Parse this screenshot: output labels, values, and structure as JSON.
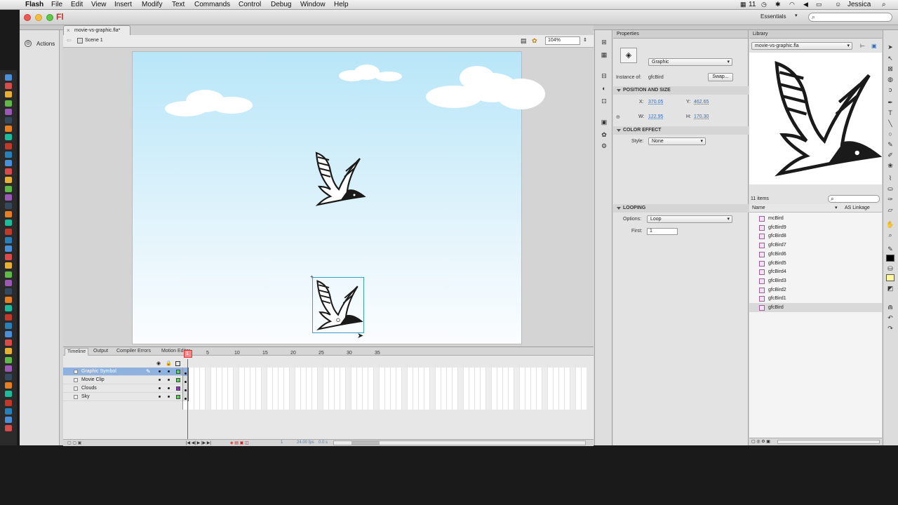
{
  "menubar": {
    "app": "Flash",
    "items": [
      "File",
      "Edit",
      "View",
      "Insert",
      "Modify",
      "Text",
      "Commands",
      "Control",
      "Debug",
      "Window",
      "Help"
    ],
    "status_number": "11",
    "user": "Jessica"
  },
  "app": {
    "logo": "Fl",
    "workspace": "Essentials",
    "actions_label": "Actions"
  },
  "document": {
    "tab": "movie-vs-graphic.fla*",
    "scene": "Scene 1",
    "zoom": "104%"
  },
  "timeline": {
    "tabs": [
      "Timeline",
      "Output",
      "Compiler Errors",
      "Motion Editor"
    ],
    "layers": [
      {
        "name": "Graphic Symbol",
        "color": "#54d754",
        "selected": true
      },
      {
        "name": "Movie Clip",
        "color": "#54d754",
        "selected": false
      },
      {
        "name": "Clouds",
        "color": "#9b2fc9",
        "selected": false
      },
      {
        "name": "Sky",
        "color": "#54d754",
        "selected": false
      }
    ],
    "frame_numbers": [
      "5",
      "10",
      "15",
      "20",
      "25",
      "30",
      "35"
    ],
    "current_frame": "1",
    "fps": "24.00 fps",
    "time": "0.0 s"
  },
  "properties": {
    "title": "Properties",
    "symbol_type": "Graphic",
    "instance_label": "Instance of:",
    "instance_name": "gfcBird",
    "swap_label": "Swap...",
    "position_section": "POSITION AND SIZE",
    "x_label": "X:",
    "x": "370.05",
    "y_label": "Y:",
    "y": "462.65",
    "w_label": "W:",
    "w": "122.95",
    "h_label": "H:",
    "h": "170.30",
    "color_section": "COLOR EFFECT",
    "style_label": "Style:",
    "style_value": "None",
    "looping_section": "LOOPING",
    "options_label": "Options:",
    "options_value": "Loop",
    "first_label": "First:",
    "first_value": "1"
  },
  "library": {
    "title": "Library",
    "file": "movie-vs-graphic.fla",
    "count": "11 items",
    "col_name": "Name",
    "col_linkage": "AS Linkage",
    "items": [
      {
        "name": "mcBird",
        "selected": false
      },
      {
        "name": "gfcBird9",
        "selected": false
      },
      {
        "name": "gfcBird8",
        "selected": false
      },
      {
        "name": "gfcBird7",
        "selected": false
      },
      {
        "name": "gfcBird6",
        "selected": false
      },
      {
        "name": "gfcBird5",
        "selected": false
      },
      {
        "name": "gfcBird4",
        "selected": false
      },
      {
        "name": "gfcBird3",
        "selected": false
      },
      {
        "name": "gfcBird2",
        "selected": false
      },
      {
        "name": "gfcBird1",
        "selected": false
      },
      {
        "name": "gfcBird",
        "selected": true
      }
    ]
  },
  "colors": {
    "stroke": "#000000",
    "fill": "#fff899",
    "selection": "#8fb1df",
    "playhead": "#e33333"
  }
}
